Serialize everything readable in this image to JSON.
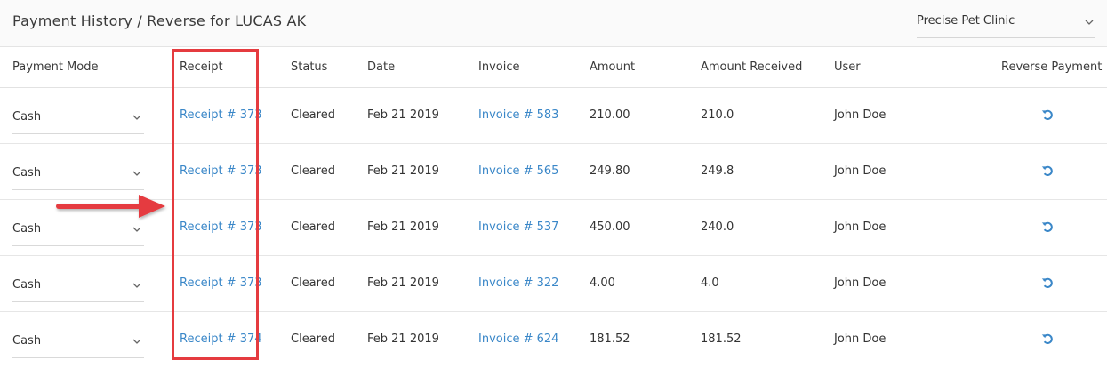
{
  "header": {
    "title": "Payment History / Reverse for LUCAS AK",
    "clinic_selected": "Precise Pet Clinic"
  },
  "columns": [
    "Payment Mode",
    "Receipt",
    "Status",
    "Date",
    "Invoice",
    "Amount",
    "Amount Received",
    "User",
    "Reverse Payment"
  ],
  "rows": [
    {
      "mode": "Cash",
      "receipt": "Receipt # 373",
      "status": "Cleared",
      "date": "Feb 21 2019",
      "invoice": "Invoice # 583",
      "amount": "210.00",
      "received": "210.0",
      "user": "John Doe"
    },
    {
      "mode": "Cash",
      "receipt": "Receipt # 373",
      "status": "Cleared",
      "date": "Feb 21 2019",
      "invoice": "Invoice # 565",
      "amount": "249.80",
      "received": "249.8",
      "user": "John Doe"
    },
    {
      "mode": "Cash",
      "receipt": "Receipt # 373",
      "status": "Cleared",
      "date": "Feb 21 2019",
      "invoice": "Invoice # 537",
      "amount": "450.00",
      "received": "240.0",
      "user": "John Doe"
    },
    {
      "mode": "Cash",
      "receipt": "Receipt # 373",
      "status": "Cleared",
      "date": "Feb 21 2019",
      "invoice": "Invoice # 322",
      "amount": "4.00",
      "received": "4.0",
      "user": "John Doe"
    },
    {
      "mode": "Cash",
      "receipt": "Receipt # 374",
      "status": "Cleared",
      "date": "Feb 21 2019",
      "invoice": "Invoice # 624",
      "amount": "181.52",
      "received": "181.52",
      "user": "John Doe"
    }
  ],
  "icons": {
    "reverse": "undo-icon",
    "dropdown": "chevron-down-icon"
  },
  "colors": {
    "link": "#3a87c8",
    "annotation": "#e53b3f",
    "header_bg": "#fafafa"
  }
}
